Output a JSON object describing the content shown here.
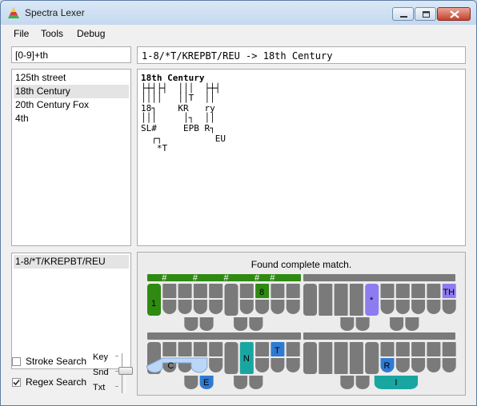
{
  "window": {
    "title": "Spectra Lexer"
  },
  "menu": {
    "file": "File",
    "tools": "Tools",
    "debug": "Debug"
  },
  "search": {
    "query": "[0-9]+th"
  },
  "results": [
    "125th street",
    "18th Century",
    "20th Century Fox",
    "4th"
  ],
  "selected_result": "18th Century",
  "header": "1-8/*T/KREPBT/REU -> 18th Century",
  "graph_lines": [
    {
      "text": "18th Century",
      "bold": true
    },
    {
      "text": "├┼┤├┤  │││  ├┼┤",
      "bold": false
    },
    {
      "text": "││││   ││T  ││",
      "bold": false
    },
    {
      "text": "18┐    KR   ry",
      "bold": false
    },
    {
      "text": "│││     │┐  ││",
      "bold": false
    },
    {
      "text": "SL#     EPB R┐",
      "bold": false
    },
    {
      "text": "  ┌┐          EU",
      "bold": false
    },
    {
      "text": "   *T",
      "bold": false
    }
  ],
  "strokes": [
    "1-8/*T/KREPBT/REU"
  ],
  "board": {
    "caption": "Found complete match.",
    "colors": {
      "number": "#2f8a12",
      "vowel_star": "#8c7cf0",
      "consonant": "#2f7ad2",
      "teal": "#1aa6a0",
      "light": "#bcd6f5",
      "key": "#7a7a7a"
    },
    "stroke1": {
      "keys": [
        "1",
        "8",
        "*",
        "TH"
      ]
    },
    "stroke2": {
      "keys": [
        "C",
        "N",
        "T",
        "E",
        "R",
        "I"
      ]
    }
  },
  "options": {
    "stroke_search": "Stroke Search",
    "regex_search": "Regex Search",
    "stroke_checked": false,
    "regex_checked": true
  },
  "slider": {
    "key": "Key",
    "snd": "Snd",
    "txt": "Txt",
    "value": "Snd"
  }
}
